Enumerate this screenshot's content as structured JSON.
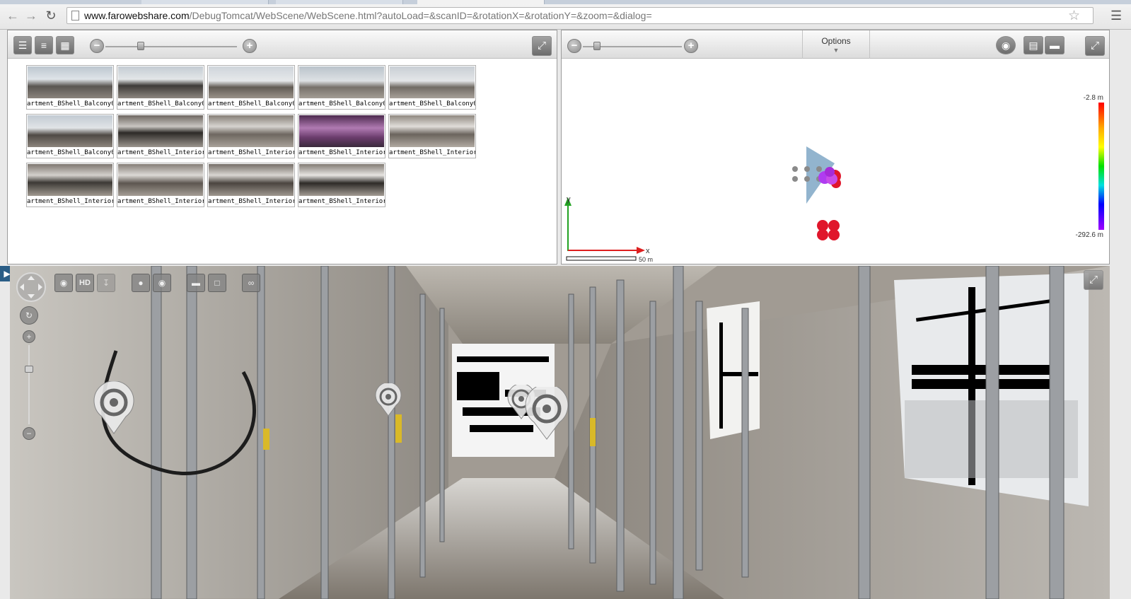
{
  "browser": {
    "url_host": "www.farowebshare.com",
    "url_path": "/DebugTomcat/WebScene/WebScene.html?autoLoad=&scanID=&rotationX=&rotationY=&zoom=&dialog="
  },
  "list_panel": {
    "thumbnails": [
      {
        "label": "artment_BShell_Balcony0(",
        "kind": "balcony"
      },
      {
        "label": "artment_BShell_Balcony0(",
        "kind": "balcony2"
      },
      {
        "label": "artment_BShell_Balcony0(",
        "kind": "balcony3"
      },
      {
        "label": "artment_BShell_Balcony0(",
        "kind": "balcony4"
      },
      {
        "label": "artment_BShell_Balcony0(",
        "kind": "balcony5"
      },
      {
        "label": "artment_BShell_Balcony0(",
        "kind": "balcony6"
      },
      {
        "label": "artment_BShell_Interior0(",
        "kind": "interior"
      },
      {
        "label": "artment_BShell_Interior0(",
        "kind": "interior2"
      },
      {
        "label": "artment_BShell_Interior0(",
        "kind": "interior3"
      },
      {
        "label": "artment_BShell_Interior0(",
        "kind": "interior4"
      },
      {
        "label": "artment_BShell_Interior0(",
        "kind": "interior5"
      },
      {
        "label": "artment_BShell_Interior0(",
        "kind": "interior6"
      },
      {
        "label": "artment_BShell_Interior0(",
        "kind": "interior7"
      },
      {
        "label": "artment_BShell_Interior0(",
        "kind": "interior8"
      }
    ]
  },
  "map_panel": {
    "options_label": "Options",
    "scale_top": "-2.8 m",
    "scale_bottom": "-292.6 m",
    "axis_x": "x",
    "axis_y": "y",
    "scale_bar": "50 m"
  },
  "pano_panel": {
    "hd_label": "HD"
  },
  "colors": {
    "accent": "#2a5d86",
    "scan_point": "#e0162b",
    "scan_point_active": "#b03cf0"
  }
}
